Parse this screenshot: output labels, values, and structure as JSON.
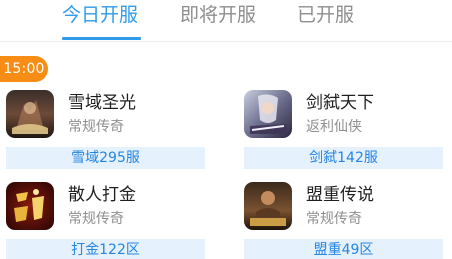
{
  "tabs": [
    {
      "label": "今日开服",
      "active": true
    },
    {
      "label": "即将开服",
      "active": false
    },
    {
      "label": "已开服",
      "active": false
    }
  ],
  "time_slot": "15:00",
  "games": [
    {
      "name": "雪域圣光",
      "genre": "常规传奇",
      "server": "雪域295服",
      "icon": "game-icon-xueyu"
    },
    {
      "name": "剑弑天下",
      "genre": "返利仙侠",
      "server": "剑弑142服",
      "icon": "game-icon-jianshi"
    },
    {
      "name": "散人打金",
      "genre": "常规传奇",
      "server": "打金122区",
      "icon": "game-icon-dajin"
    },
    {
      "name": "盟重传说",
      "genre": "常规传奇",
      "server": "盟重49区",
      "icon": "game-icon-mengzhong"
    }
  ],
  "colors": {
    "accent": "#2f9bea",
    "badge": "#f78d14",
    "server_bg": "#e5f1fc",
    "server_text": "#2585e3"
  }
}
